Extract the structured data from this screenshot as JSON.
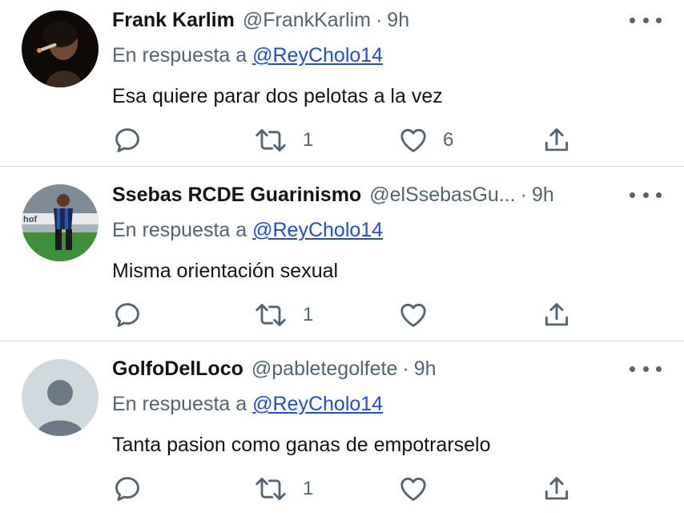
{
  "tweets": [
    {
      "name": "Frank Karlim",
      "handle": "@FrankKarlim",
      "separator": "·",
      "time": "9h",
      "reply_prefix": "En respuesta a",
      "reply_to": "@ReyCholo14",
      "text": "Esa quiere parar dos pelotas a la vez",
      "retweets": "1",
      "likes": "6"
    },
    {
      "name": "Ssebas RCDE Guarinismo",
      "handle": "@elSsebasGu...",
      "separator": "·",
      "time": "9h",
      "reply_prefix": "En respuesta a",
      "reply_to": "@ReyCholo14",
      "text": "Misma orientación sexual",
      "retweets": "1",
      "likes": ""
    },
    {
      "name": "GolfoDelLoco",
      "handle": "@pabletegolfete",
      "separator": "·",
      "time": "9h",
      "reply_prefix": "En respuesta a",
      "reply_to": "@ReyCholo14",
      "text": "Tanta pasion como ganas de empotrarselo",
      "retweets": "1",
      "likes": ""
    }
  ],
  "icons": {
    "reply": "reply-icon",
    "retweet": "retweet-icon",
    "like": "heart-icon",
    "share": "share-icon",
    "more": "more-icon"
  },
  "colors": {
    "text": "#0f1419",
    "secondary": "#536471",
    "link": "#1d4ed8",
    "divider": "#cfd9de"
  }
}
